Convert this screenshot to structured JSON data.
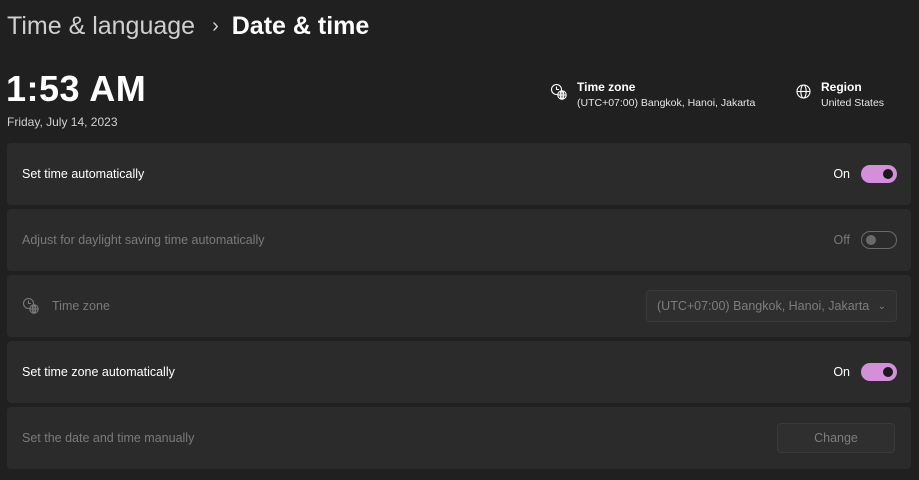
{
  "breadcrumb": {
    "parent": "Time & language",
    "separator": "›",
    "current": "Date & time"
  },
  "clock": {
    "time": "1:53 AM",
    "date": "Friday, July 14, 2023"
  },
  "info": {
    "timezone": {
      "title": "Time zone",
      "value": "(UTC+07:00) Bangkok, Hanoi, Jakarta",
      "icon": "clock-globe-icon"
    },
    "region": {
      "title": "Region",
      "value": "United States",
      "icon": "globe-icon"
    }
  },
  "settings": {
    "set_time_auto": {
      "label": "Set time automatically",
      "state": "On"
    },
    "daylight_saving": {
      "label": "Adjust for daylight saving time automatically",
      "state": "Off"
    },
    "time_zone": {
      "label": "Time zone",
      "value": "(UTC+07:00) Bangkok, Hanoi, Jakarta"
    },
    "set_tz_auto": {
      "label": "Set time zone automatically",
      "state": "On"
    },
    "manual": {
      "label": "Set the date and time manually",
      "button": "Change"
    }
  },
  "colors": {
    "accent": "#d48fda",
    "background": "#202020",
    "card": "#2b2b2b"
  }
}
